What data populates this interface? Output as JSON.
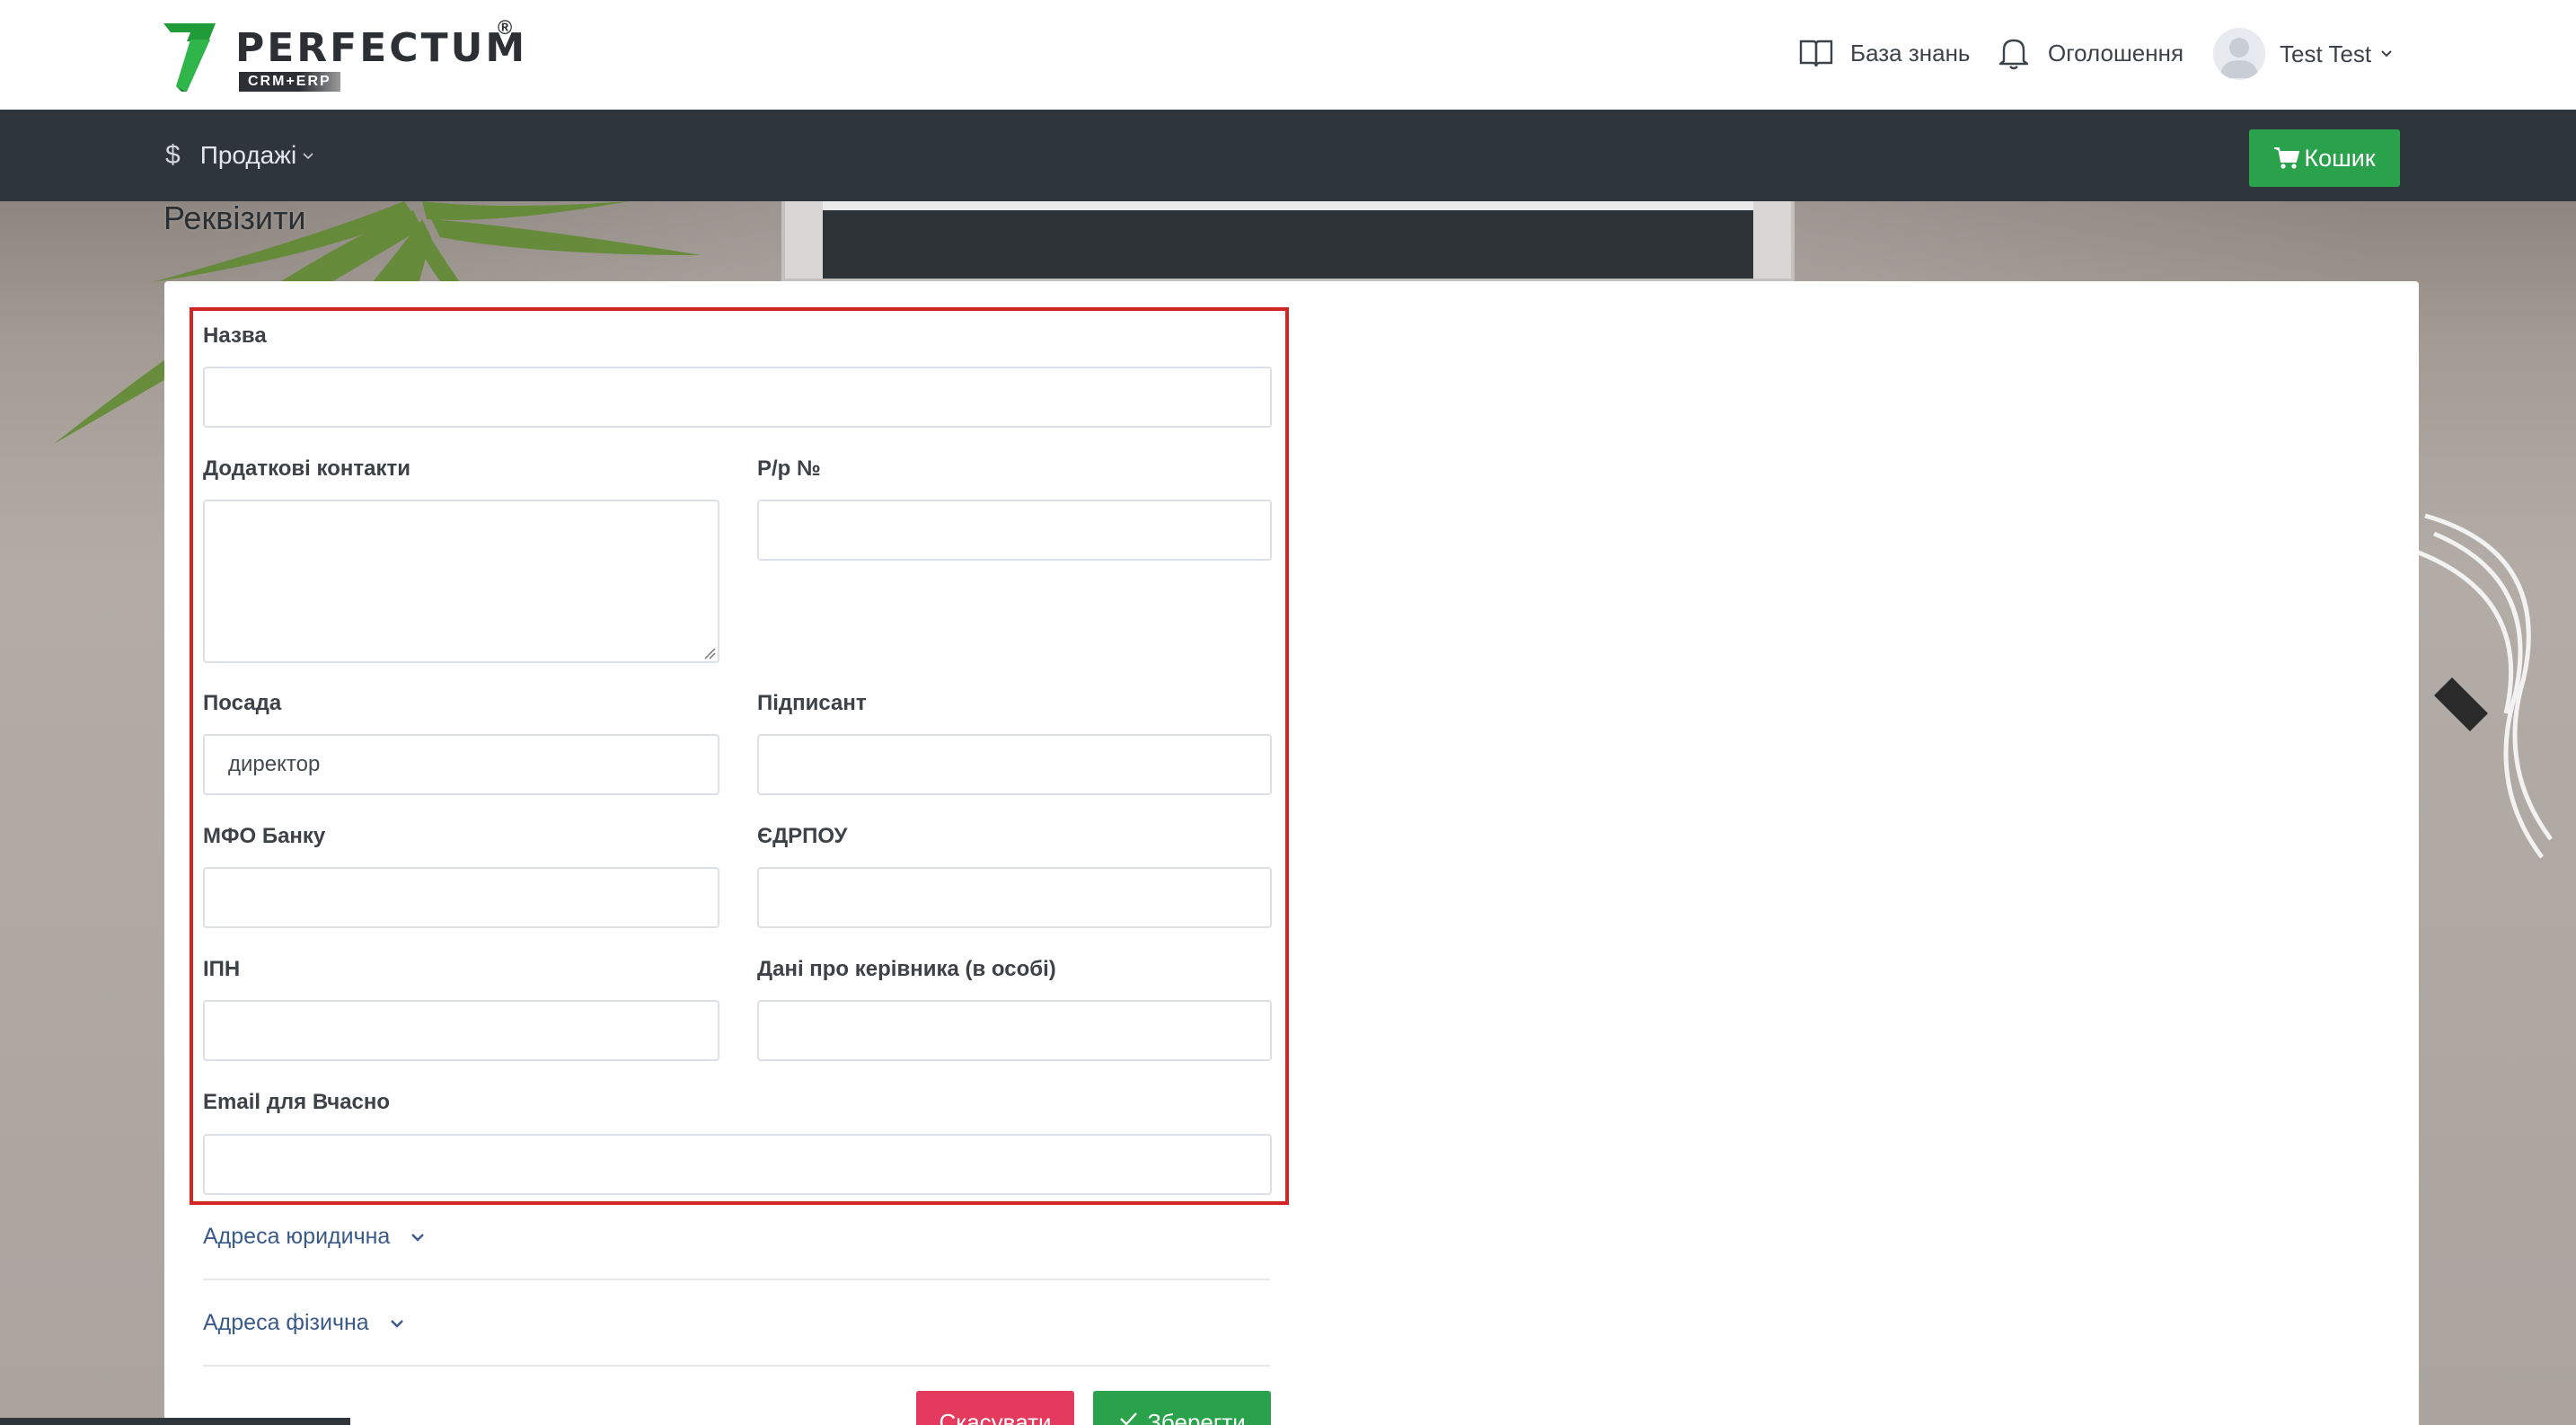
{
  "brand": {
    "name": "PERFECTUM",
    "registered": "®",
    "subtitle": "CRM+ERP",
    "accent_color": "#2aa24c"
  },
  "header": {
    "knowledge_base": "База знань",
    "announcements": "Оголошення",
    "user_name": "Test Test"
  },
  "navbar": {
    "sales_icon": "$",
    "sales_label": "Продажі",
    "cart_label": "Кошик"
  },
  "page": {
    "title": "Реквізити"
  },
  "form": {
    "name_label": "Назва",
    "name_value": "",
    "extra_contacts_label": "Додаткові контакти",
    "account_label": "Р/р №",
    "position_label": "Посада",
    "position_value": "директор",
    "signer_label": "Підписант",
    "mfo_label": "МФО Банку",
    "edrpou_label": "ЄДРПОУ",
    "ipn_label": "ІПН",
    "director_label": "Дані про керівника (в особі)",
    "email_label": "Email для Вчасно",
    "legal_address_label": "Адреса юридична",
    "physical_address_label": "Адреса фізична",
    "cancel_label": "Скасувати",
    "save_label": "Зберегти"
  },
  "colors": {
    "navbar": "#2e353b",
    "highlight_border": "#d52424",
    "cancel": "#e33a5e",
    "save": "#2aa24c"
  }
}
